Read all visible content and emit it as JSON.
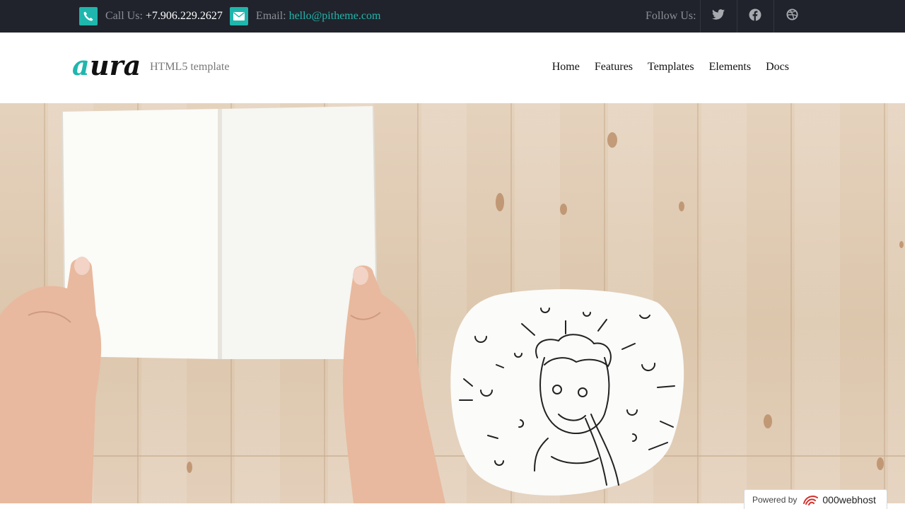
{
  "topbar": {
    "call_label": "Call Us:",
    "phone": "+7.906.229.2627",
    "email_label": "Email:",
    "email": "hello@pitheme.com",
    "follow_label": "Follow Us:",
    "social": [
      "twitter-icon",
      "facebook-icon",
      "dribbble-icon"
    ]
  },
  "header": {
    "logo_text": "aura",
    "tagline": "HTML5 template",
    "nav": [
      "Home",
      "Features",
      "Templates",
      "Elements",
      "Docs"
    ]
  },
  "badge": {
    "prefix": "Powered by",
    "brand": "000webhost"
  },
  "colors": {
    "accent": "#1fb6ad",
    "topbar_bg": "#20232b",
    "wood": "#dcc6ac"
  }
}
